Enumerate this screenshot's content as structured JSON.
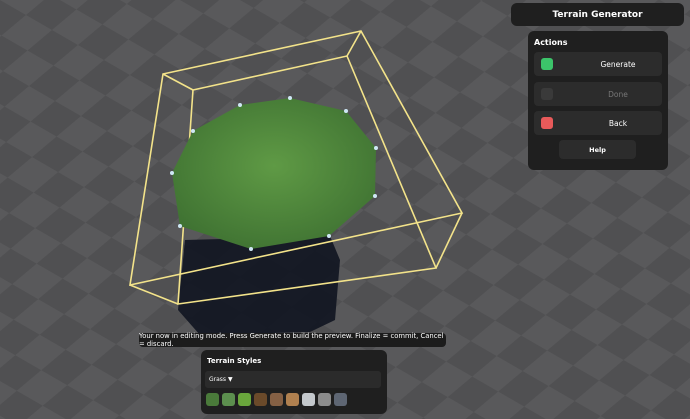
{
  "header": {
    "title": "Terrain Generator"
  },
  "actions": {
    "heading": "Actions",
    "buttons": [
      {
        "label": "Generate",
        "color": "#3cc46a",
        "enabled": true
      },
      {
        "label": "Done",
        "color": "#3a3a3a",
        "enabled": false
      },
      {
        "label": "Back",
        "color": "#e85a5a",
        "enabled": true
      }
    ],
    "help_label": "Help"
  },
  "hint": "Your now in editing mode. Press Generate to build the preview. Finalize = commit, Cancel = discard.",
  "styles": {
    "heading": "Terrain Styles",
    "selected": "Grass",
    "arrow": "▼",
    "swatches": [
      "#4a7a3a",
      "#5c8f4e",
      "#6aa63c",
      "#6b4a2a",
      "#856044",
      "#b0804f",
      "#c4c8cc",
      "#8c8c8c",
      "#5e6673"
    ]
  }
}
